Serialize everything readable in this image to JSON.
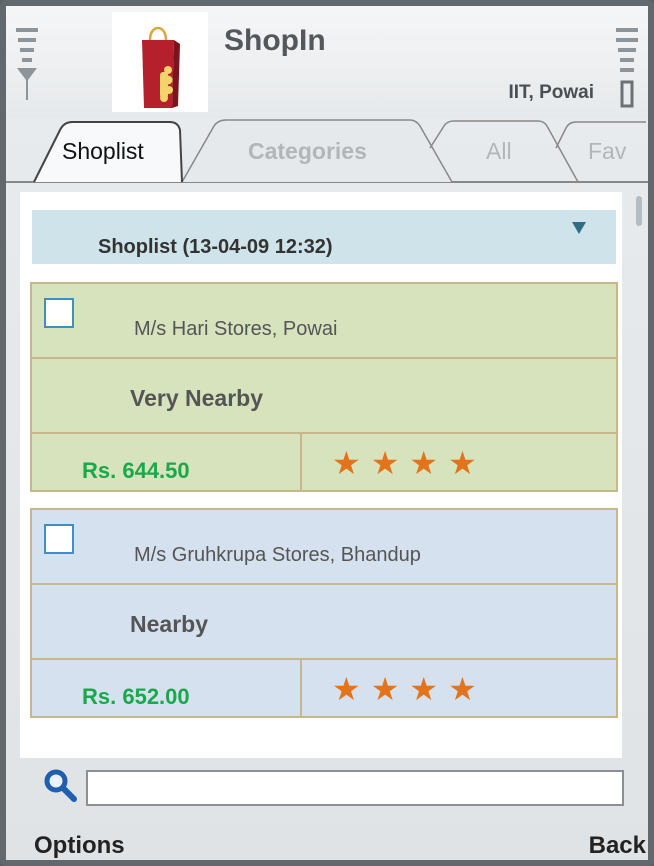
{
  "app": {
    "title": "ShopIn",
    "location": "IIT, Powai"
  },
  "tabs": [
    {
      "label": "Shoplist",
      "active": true
    },
    {
      "label": "Categories",
      "active": false
    },
    {
      "label": "All",
      "active": false
    },
    {
      "label": "Fav",
      "active": false
    }
  ],
  "shoplist": {
    "dropdown_label": "Shoplist (13-04-09 12:32)",
    "stores": [
      {
        "name": "M/s Hari Stores, Powai",
        "distance": "Very Nearby",
        "price": "Rs. 644.50",
        "rating": 4,
        "checked": false,
        "color": "#d6e3bd"
      },
      {
        "name": "M/s Gruhkrupa Stores, Bhandup",
        "distance": "Nearby",
        "price": "Rs. 652.00",
        "rating": 4,
        "checked": false,
        "color": "#d6e1ef"
      }
    ]
  },
  "search": {
    "value": "",
    "placeholder": ""
  },
  "softkeys": {
    "left": "Options",
    "right": "Back"
  },
  "icons": {
    "signal": "signal-strength-icon",
    "battery": "battery-icon",
    "search": "search-icon",
    "logo": "shopping-bag-logo"
  },
  "colors": {
    "price": "#19a84a",
    "star": "#e3741b",
    "checkbox_border": "#3f8fc5",
    "dropdown_bg": "#cfe3ea"
  }
}
